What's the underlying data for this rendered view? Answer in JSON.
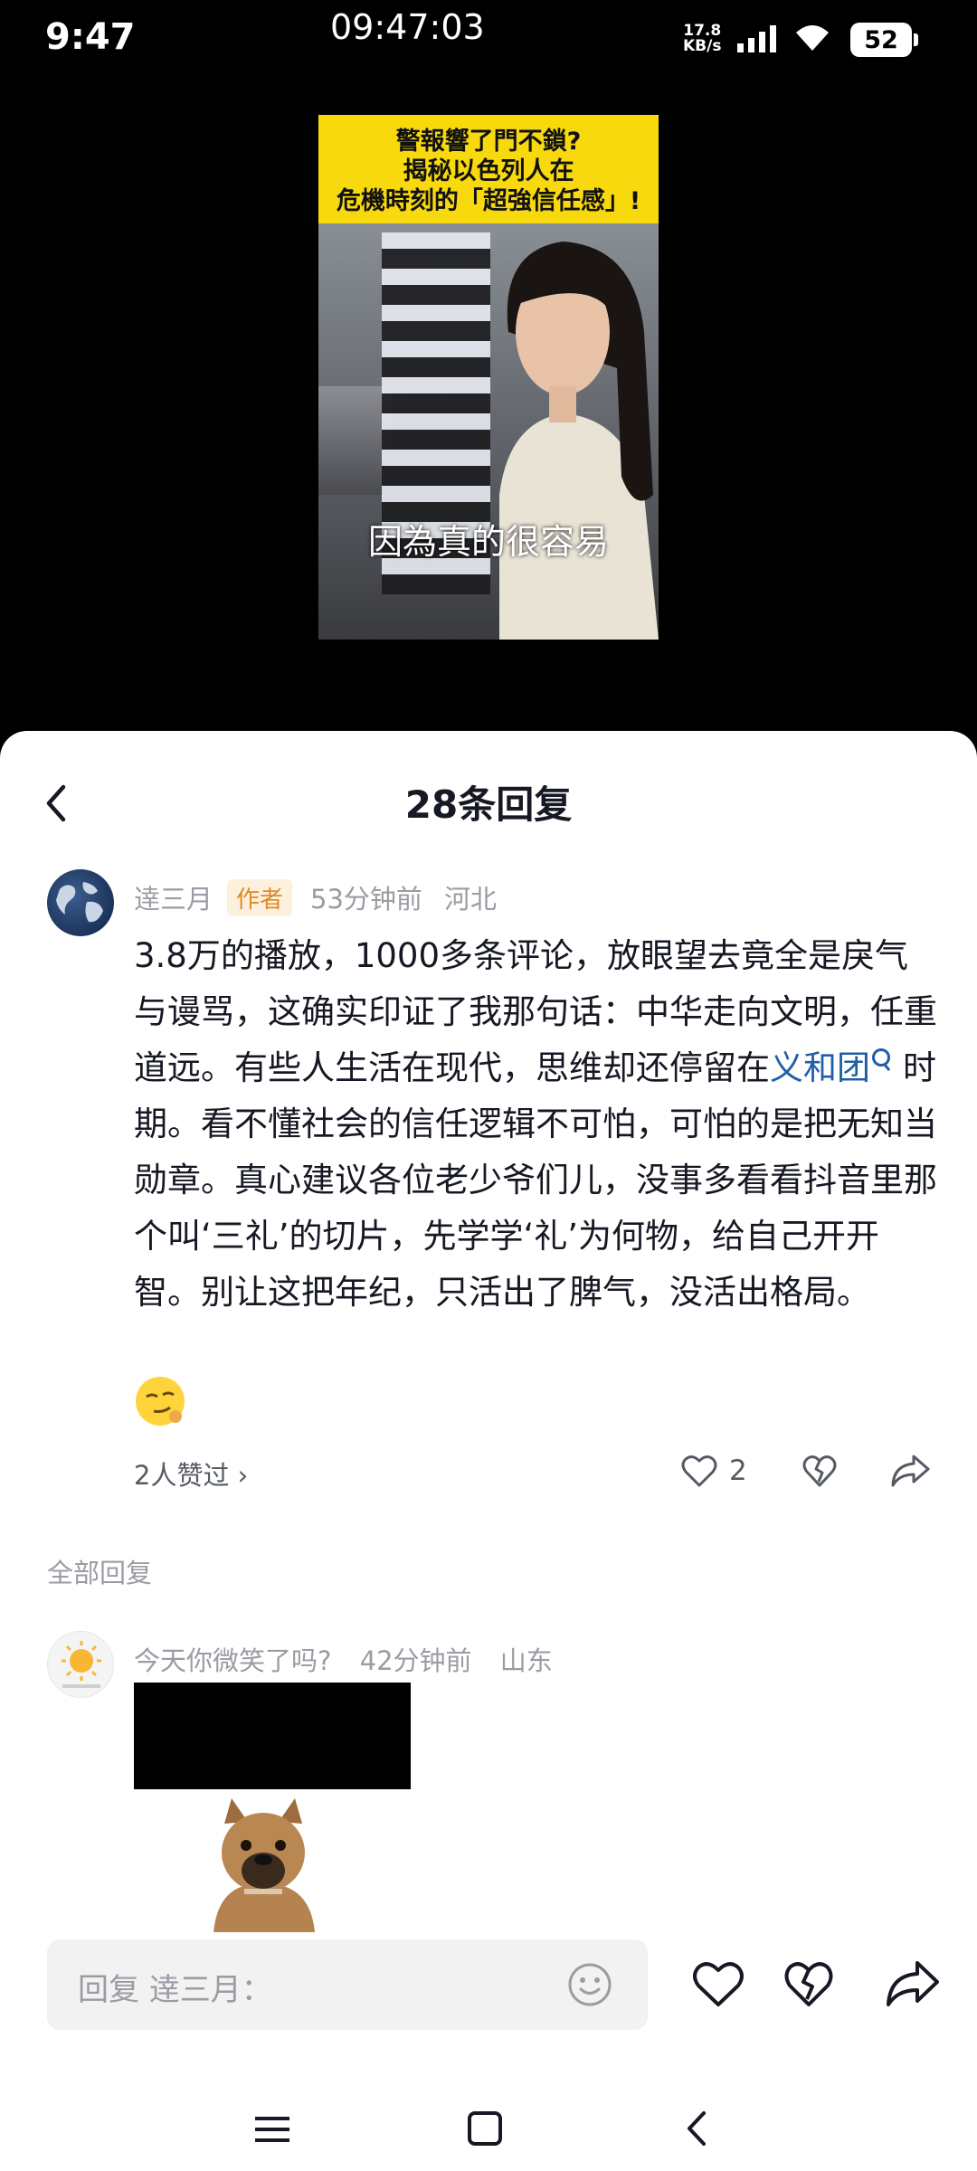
{
  "status_bar": {
    "time": "9:47",
    "clock": "09:47:03",
    "net_speed_value": "17.8",
    "net_speed_unit": "KB/s",
    "battery": "52"
  },
  "video": {
    "banner_lines": [
      "警報響了門不鎖?",
      "揭秘以色列人在",
      "危機時刻的「超強信任感」!"
    ],
    "caption": "因為真的很容易"
  },
  "sheet": {
    "title": "28条回复"
  },
  "main_comment": {
    "username": "逹三月",
    "badge": "作者",
    "time": "53分钟前",
    "location": "河北",
    "text_before_link": "3.8万的播放，1000多条评论，放眼望去竟全是戾气与谩骂，这确实印证了我那句话：中华走向文明，任重道远。有些人生活在现代，思维却还停留在",
    "link_text": "义和团",
    "text_after_link": "时期。看不懂社会的信任逻辑不可怕，可怕的是把无知当勋章。真心建议各位老少爷们儿，没事多看看抖音里那个叫‘三礼’的切片，先学学‘礼’为何物，给自己开开智。别让这把年纪，只活出了脾气，没活出格局。",
    "likers": "2人赞过 ›",
    "like_count": "2"
  },
  "replies_section": {
    "label": "全部回复"
  },
  "reply": {
    "username": "今天你微笑了吗?",
    "time": "42分钟前",
    "location": "山东"
  },
  "reply_bar": {
    "placeholder": "回复 逹三月："
  },
  "icons": {
    "back": "chevron-left-icon",
    "like": "heart-icon",
    "dislike": "broken-heart-icon",
    "share": "share-arrow-icon",
    "emoji": "smile-icon"
  }
}
